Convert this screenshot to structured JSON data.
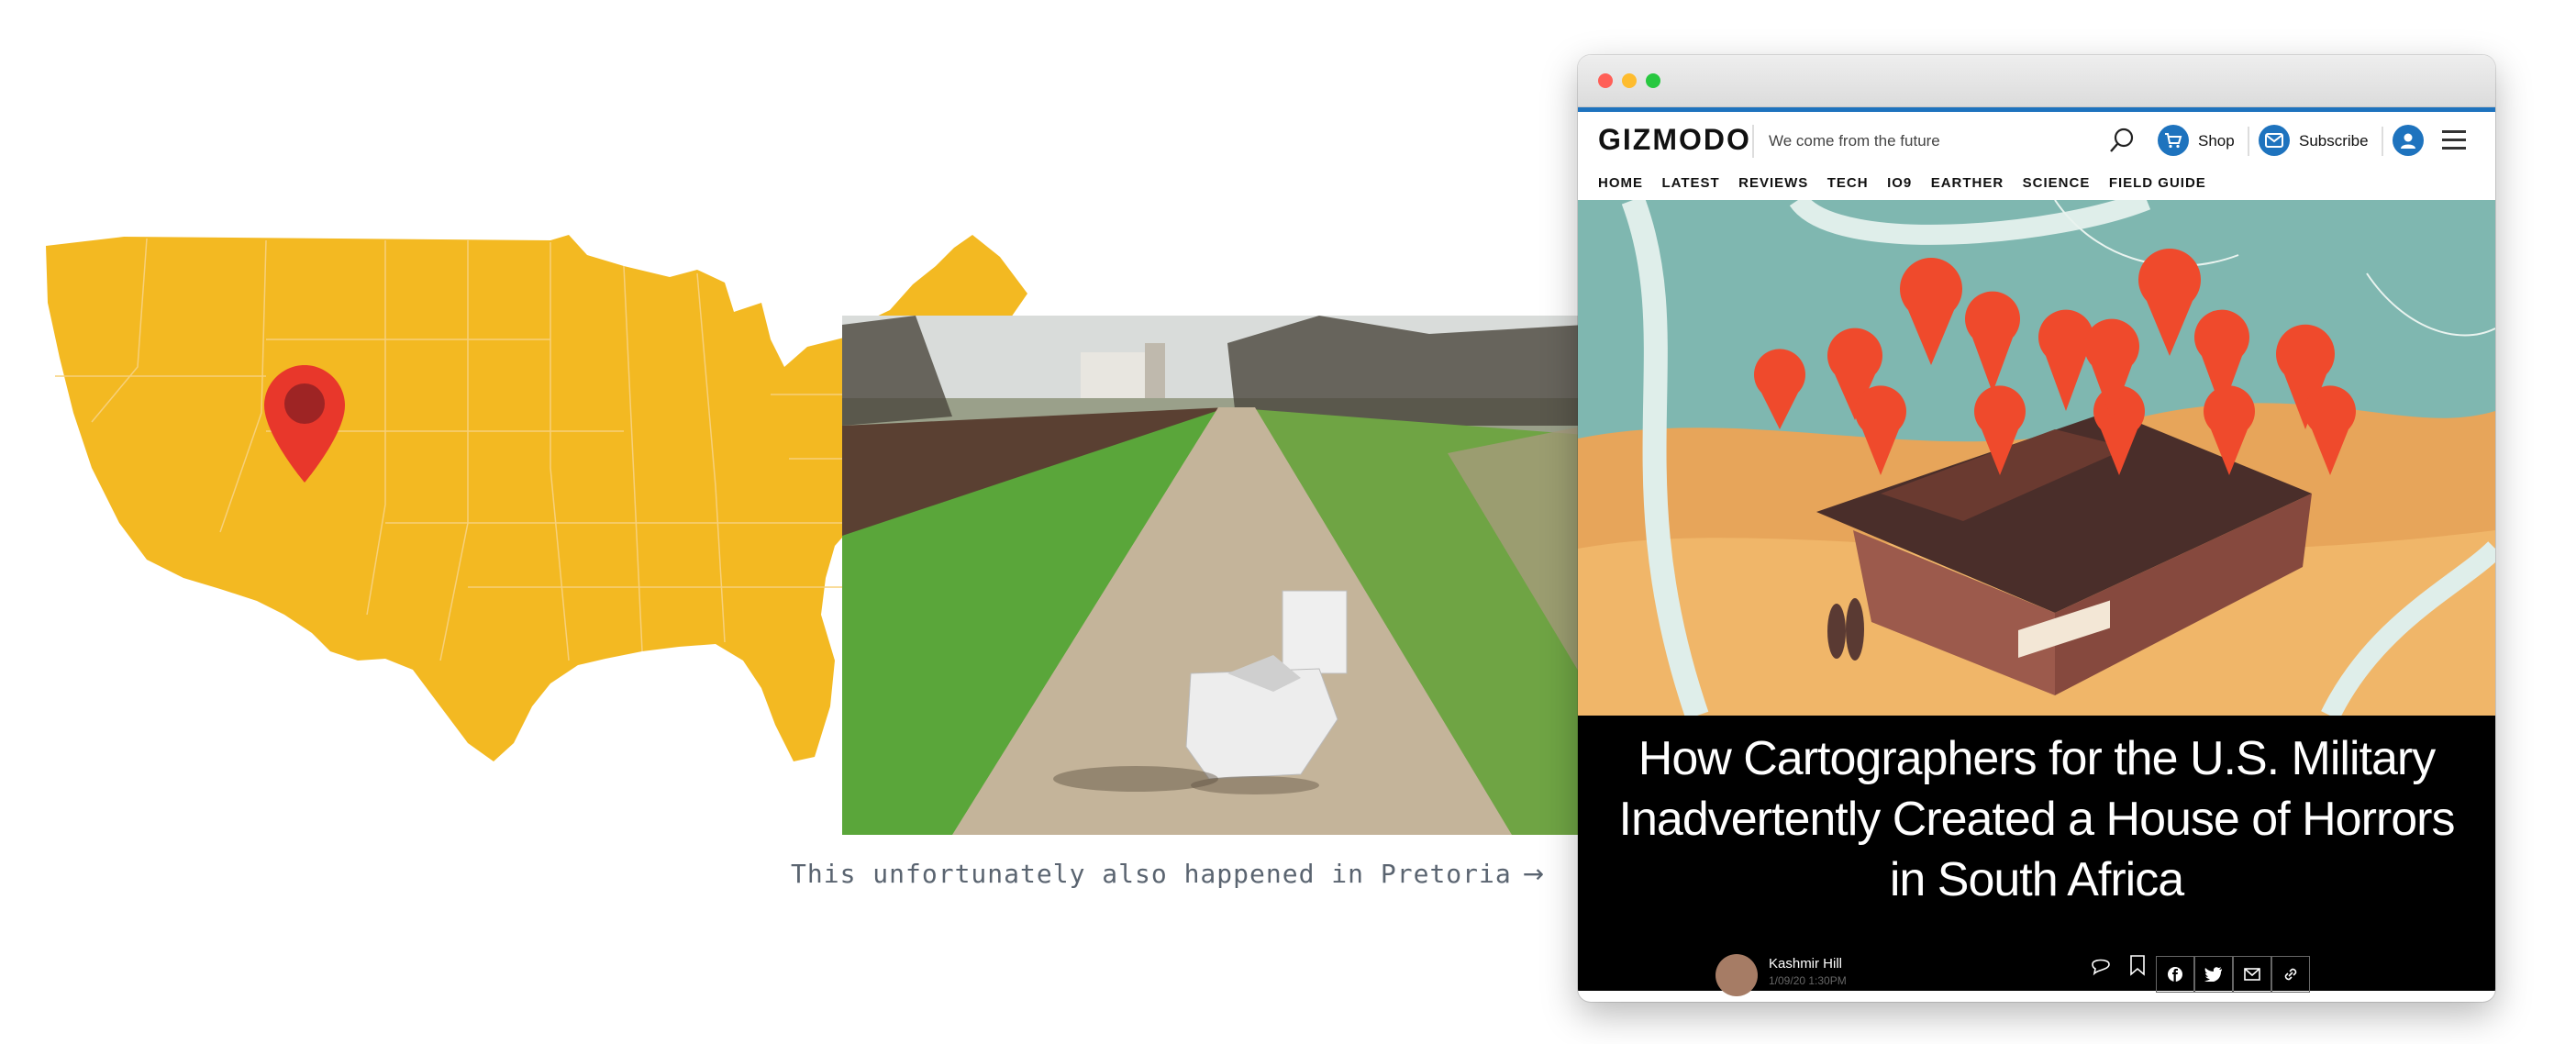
{
  "caption": {
    "text": "This unfortunately also happened in Pretoria",
    "arrow": "→"
  },
  "colors": {
    "map_fill": "#f3b922",
    "pin": "#e8372b",
    "accent": "#1e73be"
  },
  "browser": {
    "site": {
      "logo": "GIZMODO",
      "tagline": "We come from the future",
      "shop_label": "Shop",
      "subscribe_label": "Subscribe",
      "icons": [
        "search-icon",
        "cart-icon",
        "mail-icon",
        "user-icon",
        "menu-icon"
      ]
    },
    "nav": [
      "HOME",
      "LATEST",
      "REVIEWS",
      "TECH",
      "IO9",
      "EARTHER",
      "SCIENCE",
      "FIELD GUIDE"
    ],
    "article": {
      "headline": "How Cartographers for the U.S. Military Inadvertently Created a House of Horrors in South Africa",
      "author": "Kashmir Hill",
      "date": "1/09/20 1:30PM"
    },
    "share_icons": [
      "facebook-icon",
      "twitter-icon",
      "mail-icon",
      "link-icon"
    ]
  }
}
